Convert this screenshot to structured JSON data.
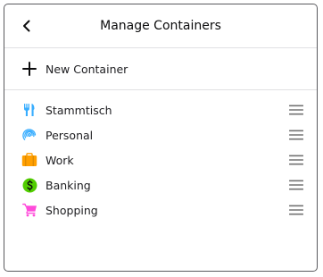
{
  "header": {
    "title": "Manage Containers",
    "back_icon": "chevron-left-icon"
  },
  "new_container": {
    "label": "New Container",
    "icon": "plus-icon"
  },
  "containers": [
    {
      "label": "Stammtisch",
      "icon": "food-icon",
      "color": "#37adff"
    },
    {
      "label": "Personal",
      "icon": "fingerprint-icon",
      "color": "#37adff"
    },
    {
      "label": "Work",
      "icon": "briefcase-icon",
      "color": "#ff9f00"
    },
    {
      "label": "Banking",
      "icon": "dollar-icon",
      "color": "#51cd00"
    },
    {
      "label": "Shopping",
      "icon": "cart-icon",
      "color": "#ff4bda"
    }
  ]
}
